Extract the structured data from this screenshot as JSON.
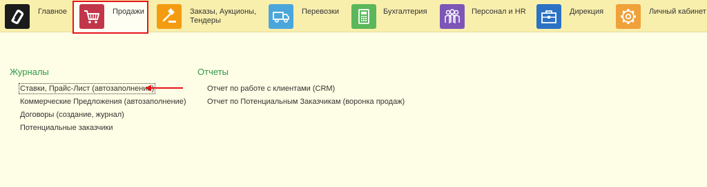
{
  "nav": {
    "items": [
      {
        "label": "Главное",
        "icon": "spiral-logo-icon",
        "color": "#1b1b1b"
      },
      {
        "label": "Продажи",
        "icon": "shopping-cart-icon",
        "color": "#c2364a",
        "selected": true
      },
      {
        "label": "Заказы,  Аукционы, Тендеры",
        "icon": "gavel-icon",
        "color": "#f39c12"
      },
      {
        "label": "Перевозки",
        "icon": "truck-icon",
        "color": "#4ba6dc"
      },
      {
        "label": "Бухгалтерия",
        "icon": "calculator-icon",
        "color": "#5cb75a"
      },
      {
        "label": "Персонал и HR",
        "icon": "people-icon",
        "color": "#7d56b8"
      },
      {
        "label": "Дирекция",
        "icon": "briefcase-icon",
        "color": "#2b72c4"
      },
      {
        "label": "Личный кабинет",
        "icon": "gear-icon",
        "color": "#f0a13a"
      }
    ]
  },
  "journals": {
    "title": "Журналы",
    "links": [
      "Ставки, Прайс-Лист (автозаполнение)",
      "Коммерческие Предложения (автозаполнение)",
      "Договоры (создание, журнал)",
      "Потенциальные заказчики"
    ]
  },
  "reports": {
    "title": "Отчеты",
    "links": [
      "Отчет по работе с клиентами (CRM)",
      "Отчет по Потенциальным Заказчикам (воронка продаж)"
    ]
  },
  "colors": {
    "accent_green": "#2f9a4b",
    "highlight_red": "#e4141b",
    "topbar_bg": "#f9efad",
    "page_bg": "#fefde5"
  }
}
